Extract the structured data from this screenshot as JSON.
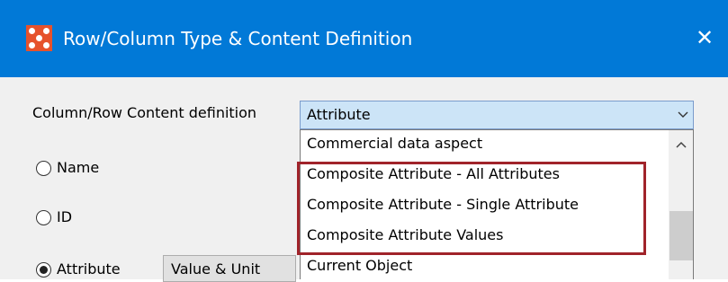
{
  "window": {
    "title": "Row/Column Type & Content Definition",
    "close_icon": "close-icon",
    "app_icon": "app-icon"
  },
  "content_definition": {
    "label": "Column/Row Content definition",
    "selected_value": "Attribute"
  },
  "dropdown": {
    "items": [
      "Commercial data aspect",
      "Composite Attribute - All Attributes",
      "Composite Attribute - Single Attribute",
      "Composite Attribute Values",
      "Current Object"
    ],
    "highlighted_range": "items 2-4"
  },
  "radios": [
    {
      "label": "Name",
      "checked": false
    },
    {
      "label": "ID",
      "checked": false
    },
    {
      "label": "Attribute",
      "checked": true
    }
  ],
  "attribute_field": {
    "value": "Value & Unit"
  },
  "colors": {
    "titlebar": "#0179d7",
    "combo_selected": "#cce4f7",
    "highlight_border": "#a0232a",
    "app_icon": "#e6522c"
  }
}
